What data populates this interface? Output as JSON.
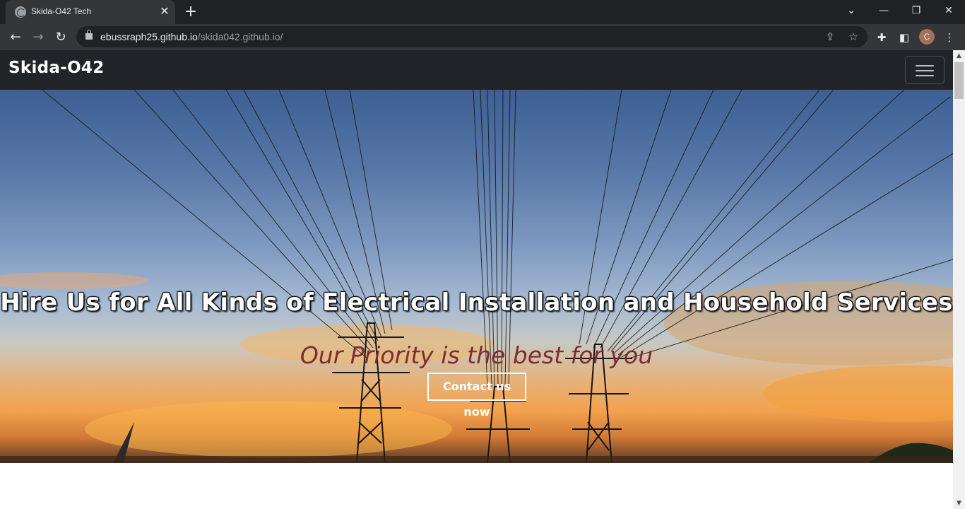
{
  "browser": {
    "tab_title": "Skida-O42 Tech",
    "url_host": "ebussraph25.github.io",
    "url_path": "/skida042.github.io/",
    "profile_initial": "C"
  },
  "navbar": {
    "brand": "Skida-O42"
  },
  "hero": {
    "title": "Hire Us for All Kinds of Electrical Installation and Household Services",
    "subtitle": "Our Priority is the best for you",
    "cta_label": "Contact us now"
  },
  "colors": {
    "navbar_bg": "#212529",
    "subtitle_color": "#7a2e33",
    "chrome_dark": "#202124",
    "chrome_toolbar": "#35363a"
  }
}
